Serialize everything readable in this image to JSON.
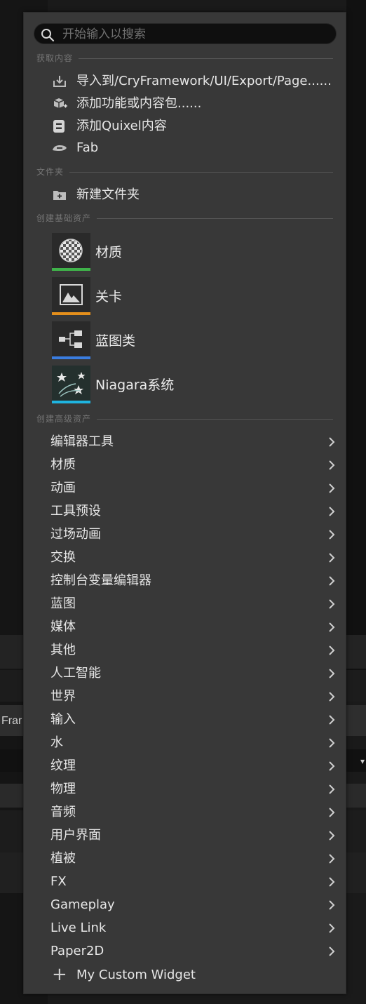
{
  "search": {
    "placeholder": "开始输入以搜索"
  },
  "sections": {
    "get_content": "获取内容",
    "folder": "文件夹",
    "basic_assets": "创建基础资产",
    "advanced_assets": "创建高级资产"
  },
  "get_content": {
    "import": "导入到/CryFramework/UI/Export/Page......",
    "add_feature": "添加功能或内容包......",
    "add_quixel": "添加Quixel内容",
    "fab": "Fab"
  },
  "folder": {
    "new_folder": "新建文件夹"
  },
  "basic_assets": [
    {
      "label": "材质",
      "bar_color": "#3fb24a"
    },
    {
      "label": "关卡",
      "bar_color": "#e48f1c"
    },
    {
      "label": "蓝图类",
      "bar_color": "#3a7de0"
    },
    {
      "label": "Niagara系统",
      "bar_color": "#1fb4e0"
    }
  ],
  "advanced_assets": [
    "编辑器工具",
    "材质",
    "动画",
    "工具预设",
    "过场动画",
    "交换",
    "控制台变量编辑器",
    "蓝图",
    "媒体",
    "其他",
    "人工智能",
    "世界",
    "输入",
    "水",
    "纹理",
    "物理",
    "音频",
    "用户界面",
    "植被",
    "FX",
    "Gameplay",
    "Live Link",
    "Paper2D"
  ],
  "custom_widget": "My Custom Widget",
  "background": {
    "fragment_text": "Frar"
  }
}
